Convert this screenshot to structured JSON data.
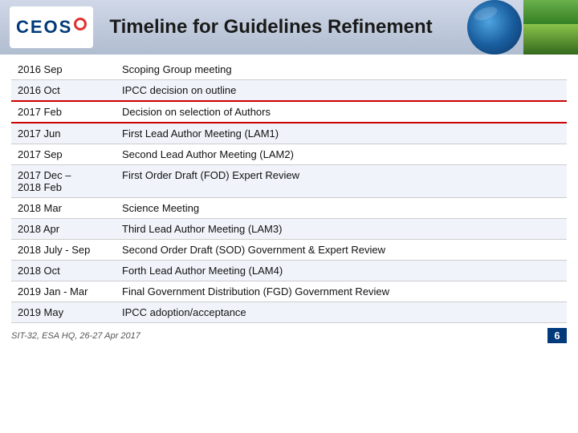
{
  "header": {
    "title": "Timeline for Guidelines Refinement",
    "logo": "CEOS",
    "footer_text": "SIT-32, ESA HQ, 26-27 Apr 2017",
    "page_number": "6"
  },
  "table": {
    "rows": [
      {
        "date": "2016 Sep",
        "event": "Scoping Group meeting",
        "highlight": false
      },
      {
        "date": "2016 Oct",
        "event": "IPCC decision on outline",
        "highlight": false
      },
      {
        "date": "2017 Feb",
        "event": "Decision on selection of Authors",
        "highlight": true
      },
      {
        "date": "2017 Jun",
        "event": "First Lead Author Meeting (LAM1)",
        "highlight": false
      },
      {
        "date": "2017 Sep",
        "event": "Second Lead Author Meeting (LAM2)",
        "highlight": false
      },
      {
        "date": "2017 Dec –\n2018 Feb",
        "event": "First Order Draft (FOD) Expert Review",
        "highlight": false
      },
      {
        "date": "2018 Mar",
        "event": "Science Meeting",
        "highlight": false
      },
      {
        "date": "2018 Apr",
        "event": "Third Lead Author Meeting (LAM3)",
        "highlight": false
      },
      {
        "date": "2018 July - Sep",
        "event": "Second Order Draft (SOD) Government & Expert Review",
        "highlight": false
      },
      {
        "date": "2018 Oct",
        "event": "Forth Lead Author Meeting (LAM4)",
        "highlight": false
      },
      {
        "date": "2019 Jan - Mar",
        "event": "Final Government Distribution (FGD) Government Review",
        "highlight": false
      },
      {
        "date": "2019 May",
        "event": "IPCC adoption/acceptance",
        "highlight": false
      }
    ]
  }
}
